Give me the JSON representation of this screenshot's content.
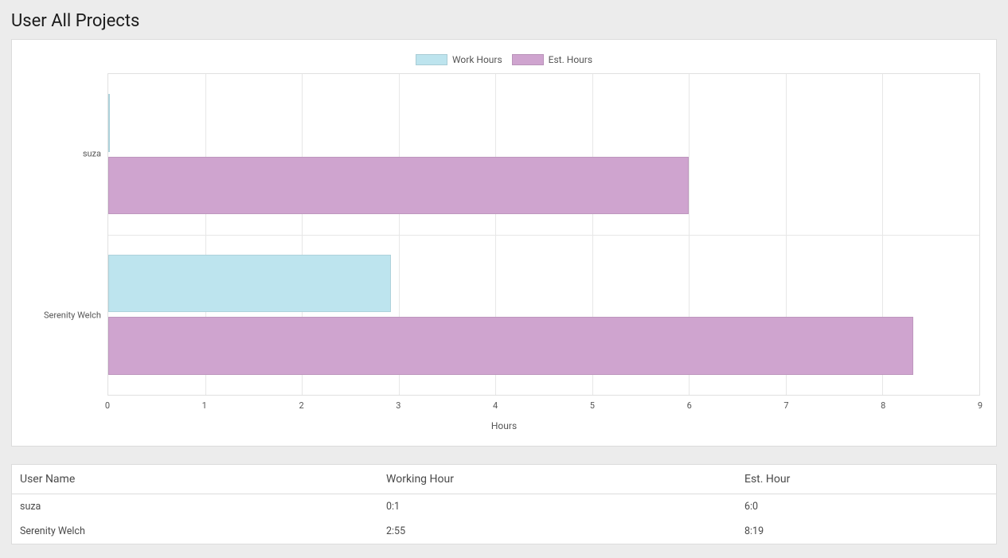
{
  "title": "User All Projects",
  "legend": {
    "work": "Work Hours",
    "est": "Est. Hours"
  },
  "xlabel": "Hours",
  "colors": {
    "work": "#bde4ee",
    "est": "#cfa4cf"
  },
  "table": {
    "headers": {
      "user": "User Name",
      "working": "Working Hour",
      "est": "Est. Hour"
    },
    "rows": [
      {
        "user": "suza",
        "working": "0:1",
        "est": "6:0"
      },
      {
        "user": "Serenity Welch",
        "working": "2:55",
        "est": "8:19"
      }
    ]
  },
  "chart_data": {
    "type": "bar",
    "orientation": "horizontal",
    "categories": [
      "suza",
      "Serenity Welch"
    ],
    "series": [
      {
        "name": "Work Hours",
        "values": [
          0.02,
          2.92
        ]
      },
      {
        "name": "Est. Hours",
        "values": [
          6.0,
          8.32
        ]
      }
    ],
    "xlim": [
      0,
      9
    ],
    "x_ticks": [
      0,
      1,
      2,
      3,
      4,
      5,
      6,
      7,
      8,
      9
    ],
    "xlabel": "Hours",
    "ylabel": "",
    "title": ""
  }
}
